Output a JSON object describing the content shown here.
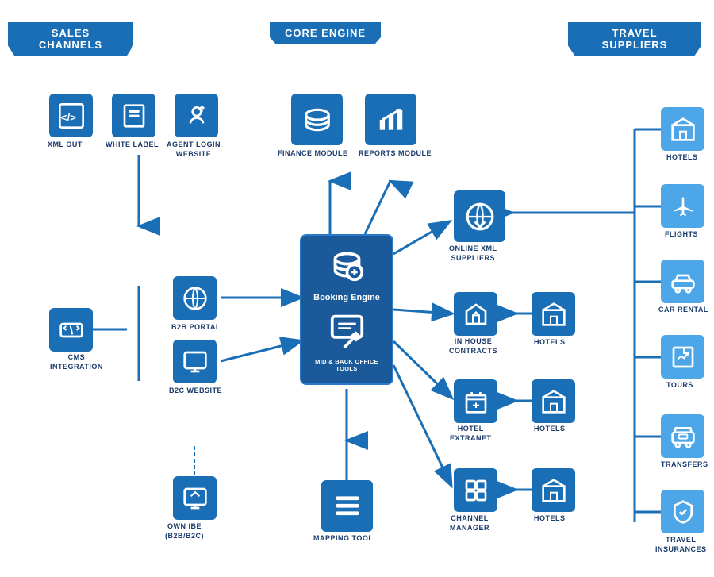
{
  "headers": {
    "sales": "SALES CHANNELS",
    "core": "CORE ENGINE",
    "travel": "TRAVEL SUPPLIERS"
  },
  "sales_items": [
    {
      "id": "xml-out",
      "label": "XML OUT"
    },
    {
      "id": "white-label",
      "label": "WHITE LABEL"
    },
    {
      "id": "agent-login",
      "label1": "AGENT LOGIN",
      "label2": "WEBSITE"
    },
    {
      "id": "b2b-portal",
      "label": "B2B PORTAL"
    },
    {
      "id": "cms-integration",
      "label1": "CMS",
      "label2": "INTEGRATION"
    },
    {
      "id": "b2c-website",
      "label": "B2C WEBSITE"
    },
    {
      "id": "own-ibe",
      "label1": "OWN IBE",
      "label2": "(B2B/B2C)"
    }
  ],
  "core_items": [
    {
      "id": "finance-module",
      "label": "FINANCE MODULE"
    },
    {
      "id": "reports-module",
      "label": "REPORTS MODULE"
    },
    {
      "id": "booking-engine",
      "label": "Booking Engine"
    },
    {
      "id": "mid-back-office",
      "label": "MID & BACK OFFICE TOOLS"
    },
    {
      "id": "mapping-tool",
      "label": "MAPPING TOOL"
    }
  ],
  "middle_items": [
    {
      "id": "online-xml",
      "label1": "ONLINE XML",
      "label2": "SUPPLIERS"
    },
    {
      "id": "in-house",
      "label1": "IN HOUSE",
      "label2": "CONTRACTS"
    },
    {
      "id": "hotels-1",
      "label": "HOTELS"
    },
    {
      "id": "hotel-extranet",
      "label1": "HOTEL",
      "label2": "EXTRANET"
    },
    {
      "id": "hotels-2",
      "label": "HOTELS"
    },
    {
      "id": "channel-manager",
      "label1": "CHANNEL",
      "label2": "MANAGER"
    },
    {
      "id": "hotels-3",
      "label": "HOTELS"
    }
  ],
  "supplier_items": [
    {
      "id": "hotels-sup",
      "label": "HOTELS"
    },
    {
      "id": "flights-sup",
      "label": "FLIGHTS"
    },
    {
      "id": "car-rental",
      "label": "CAR RENTAL"
    },
    {
      "id": "tours",
      "label": "TOURS"
    },
    {
      "id": "transfers",
      "label": "TRANSFERS"
    },
    {
      "id": "travel-ins",
      "label1": "TRAVEL",
      "label2": "INSURANCES"
    }
  ]
}
